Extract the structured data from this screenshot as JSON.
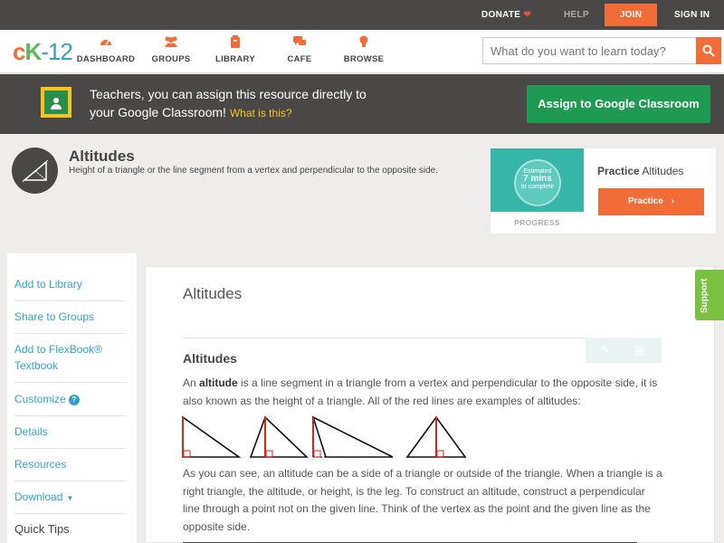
{
  "topbar": {
    "donate": "DONATE",
    "help": "HELP",
    "join": "JOIN",
    "signin": "SIGN IN"
  },
  "nav": {
    "logo": {
      "c": "c",
      "k": "K",
      "n": "-12"
    },
    "items": [
      {
        "label": "DASHBOARD",
        "icon": "dashboard-icon"
      },
      {
        "label": "GROUPS",
        "icon": "groups-icon"
      },
      {
        "label": "LIBRARY",
        "icon": "library-icon"
      },
      {
        "label": "CAFE",
        "icon": "cafe-icon"
      },
      {
        "label": "BROWSE",
        "icon": "browse-icon"
      }
    ],
    "search_placeholder": "What do you want to learn today?"
  },
  "classroom_banner": {
    "line1": "Teachers, you can assign this resource directly to",
    "line2": "your Google Classroom!",
    "what_link": "What is this?",
    "button": "Assign to Google Classroom"
  },
  "concept": {
    "title": "Altitudes",
    "description": "Height of a triangle or the line segment from a vertex and perpendicular to the opposite side."
  },
  "practice_card": {
    "estimated": "Estimated",
    "minutes": "7 mins",
    "to_complete": "to complete",
    "progress_label": "PROGRESS",
    "label_bold": "Practice",
    "label_rest": "Altitudes",
    "button": "Practice"
  },
  "sidebar": {
    "items": [
      "Add to Library",
      "Share to Groups",
      "Add to FlexBook® Textbook",
      "Customize",
      "Details",
      "Resources",
      "Download"
    ],
    "quick_tips": "Quick Tips"
  },
  "main": {
    "title": "Altitudes",
    "section_heading": "Altitudes",
    "para1_prefix": "An ",
    "para1_bold": "altitude",
    "para1_rest": " is a line segment in a triangle from a vertex and perpendicular to the opposite side, it is also known as the height of a triangle. All of the red lines are examples of altitudes:",
    "para2": "As you can see, an altitude can be a side of a triangle or outside of the triangle. When a triangle is a right triangle, the altitude, or height, is the leg. To construct an altitude, construct a perpendicular line through a point not on the given line. Think of the vertex as the point and the given line as the opposite side."
  },
  "support": "Support",
  "colors": {
    "accent_orange": "#f26c37",
    "classroom_green": "#1e9a52",
    "link_blue": "#2fa4c6",
    "altitude_red": "#d9261c",
    "support_green": "#7ac142"
  }
}
